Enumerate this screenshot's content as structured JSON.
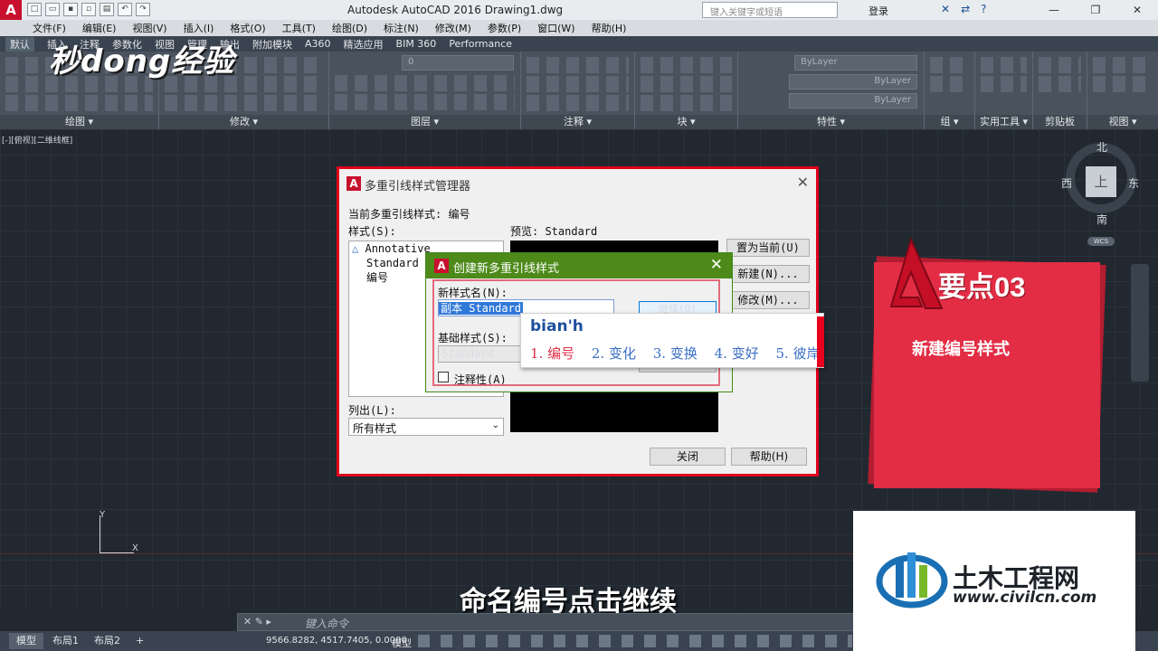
{
  "titlebar": {
    "app_title": "Autodesk AutoCAD 2016    Drawing1.dwg",
    "search_placeholder": "键入关键字或短语",
    "login": "登录"
  },
  "menu": [
    "文件(F)",
    "编辑(E)",
    "视图(V)",
    "插入(I)",
    "格式(O)",
    "工具(T)",
    "绘图(D)",
    "标注(N)",
    "修改(M)",
    "参数(P)",
    "窗口(W)",
    "帮助(H)"
  ],
  "ribbon": {
    "tabs": [
      "默认",
      "插入",
      "注释",
      "参数化",
      "视图",
      "管理",
      "输出",
      "附加模块",
      "A360",
      "精选应用",
      "BIM 360",
      "Performance"
    ],
    "panels": [
      "绘图 ▾",
      "修改 ▾",
      "图层 ▾",
      "注释 ▾",
      "块 ▾",
      "特性 ▾",
      "组 ▾",
      "实用工具 ▾",
      "剪贴板",
      "视图 ▾"
    ],
    "layer_value": "0",
    "bylayer_1": "ByLayer",
    "bylayer_2": "ByLayer",
    "bylayer_3": "ByLayer"
  },
  "watermark_top": "秒dong经验",
  "viewport_label": "[-][俯视][二维线框]",
  "ucs": {
    "y": "Y",
    "x": "X"
  },
  "viewcube": {
    "north": "北",
    "south": "南",
    "west": "西",
    "east": "东",
    "face": "上",
    "wcs": "WCS"
  },
  "manager_dialog": {
    "title": "多重引线样式管理器",
    "current_style": "当前多重引线样式: 编号",
    "styles_label": "样式(S):",
    "styles": [
      "Annotative",
      "Standard",
      "编号"
    ],
    "preview_label": "预览: Standard",
    "btn_set_current": "置为当前(U)",
    "btn_new": "新建(N)...",
    "btn_modify": "修改(M)...",
    "list_label": "列出(L):",
    "list_value": "所有样式",
    "btn_close": "关闭",
    "btn_help": "帮助(H)"
  },
  "new_dialog": {
    "title": "创建新多重引线样式",
    "name_label": "新样式名(N):",
    "name_value": "副本 Standard",
    "base_label": "基础样式(S):",
    "base_value": "Standard",
    "annotative_label": "注释性(A)",
    "btn_continue": "继续(O)"
  },
  "ime": {
    "input": "bian'h",
    "candidates": [
      "1. 编号",
      "2. 变化",
      "3. 变换",
      "4. 变好",
      "5. 彼岸"
    ]
  },
  "card": {
    "title": "要点03",
    "subtitle": "新建编号样式"
  },
  "caption": "命名编号点击继续",
  "command": {
    "placeholder": "键入命令"
  },
  "status": {
    "tabs": [
      "模型",
      "布局1",
      "布局2",
      "+"
    ],
    "coords": "9566.8282, 4517.7405, 0.0000",
    "space": "模型"
  },
  "civil_logo": {
    "title": "土木工程网",
    "url": "www.civilcn.com"
  }
}
